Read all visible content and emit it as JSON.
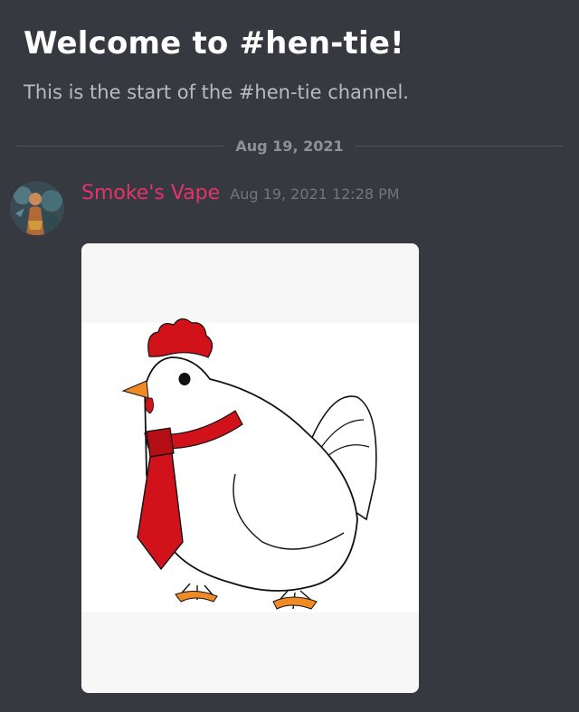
{
  "channel": {
    "welcome_title": "Welcome to #hen-tie!",
    "welcome_subtitle": "This is the start of the #hen-tie channel."
  },
  "divider": {
    "date": "Aug 19, 2021"
  },
  "message": {
    "author": "Smoke's Vape",
    "timestamp": "Aug 19, 2021 12:28 PM",
    "author_color": "#e5336a",
    "attachment": {
      "subject": "cartoon hen wearing a red necktie"
    }
  },
  "colors": {
    "background": "#36393f",
    "title": "#ffffff",
    "subtitle": "#b9bbbe",
    "muted": "#72767d"
  }
}
